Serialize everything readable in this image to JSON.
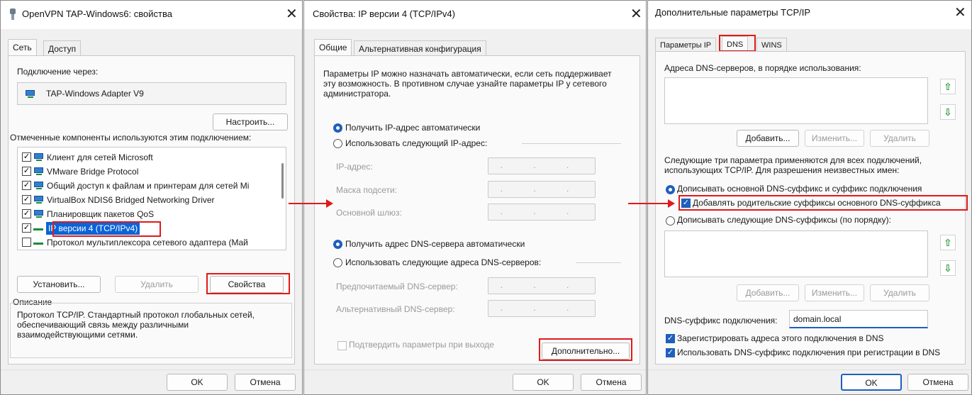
{
  "w1": {
    "title": "OpenVPN TAP-Windows6: свойства",
    "tabs": [
      "Сеть",
      "Доступ"
    ],
    "connect_via_label": "Подключение через:",
    "adapter_name": "TAP-Windows Adapter V9",
    "configure_button": "Настроить...",
    "components_label": "Отмеченные компоненты используются этим подключением:",
    "components": [
      {
        "label": "Клиент для сетей Microsoft",
        "checked": "✓"
      },
      {
        "label": "VMware Bridge Protocol",
        "checked": "✓"
      },
      {
        "label": "Общий доступ к файлам и принтерам для сетей Mi",
        "checked": "✓"
      },
      {
        "label": "VirtualBox NDIS6 Bridged Networking Driver",
        "checked": "✓"
      },
      {
        "label": "Планировщик пакетов QoS",
        "checked": "✓"
      },
      {
        "label": "IP версии 4 (TCP/IPv4)",
        "checked": "✓"
      },
      {
        "label": "Протокол мультиплексора сетевого адаптера (Maй",
        "checked": ""
      }
    ],
    "install_button": "Установить...",
    "remove_button": "Удалить",
    "properties_button": "Свойства",
    "description_title": "Описание",
    "description_text": "Протокол TCP/IP. Стандартный протокол глобальных сетей, обеспечивающий связь между различными взаимодействующими сетями.",
    "ok_button": "OK",
    "cancel_button": "Отмена"
  },
  "w2": {
    "title": "Свойства: IP версии 4 (TCP/IPv4)",
    "tabs": [
      "Общие",
      "Альтернативная конфигурация"
    ],
    "intro_text": "Параметры IP можно назначать автоматически, если сеть поддерживает эту возможность. В противном случае узнайте параметры IP у сетевого администратора.",
    "auto_ip": "Получить IP-адрес автоматически",
    "manual_ip": "Использовать следующий IP-адрес:",
    "ip_label": "IP-адрес:",
    "mask_label": "Маска подсети:",
    "gateway_label": "Основной шлюз:",
    "ip_placeholder": ". . .",
    "auto_dns": "Получить адрес DNS-сервера автоматически",
    "manual_dns": "Использовать следующие адреса DNS-серверов:",
    "pref_dns_label": "Предпочитаемый DNS-сервер:",
    "alt_dns_label": "Альтернативный DNS-сервер:",
    "validate_label": "Подтвердить параметры при выходе",
    "advanced_button": "Дополнительно...",
    "ok_button": "OK",
    "cancel_button": "Отмена"
  },
  "w3": {
    "title": "Дополнительные параметры TCP/IP",
    "tabs": [
      "Параметры IP",
      "DNS",
      "WINS"
    ],
    "dns_servers_label": "Адреса DNS-серверов, в порядке использования:",
    "add_button": "Добавить...",
    "edit_button": "Изменить...",
    "remove_button": "Удалить",
    "following_text": "Следующие три параметра применяются для всех подключений, использующих TCP/IP. Для разрешения неизвестных имен:",
    "append_primary": "Дописывать основной DNS-суффикс и суффикс подключения",
    "append_parent": "Добавлять родительские суффиксы основного DNS-суффикса",
    "append_these": "Дописывать следующие DNS-суффиксы (по порядку):",
    "conn_suffix_label": "DNS-суффикс подключения:",
    "conn_suffix_value": "domain.local",
    "register_addr": "Зарегистрировать адреса этого подключения в DNS",
    "use_suffix": "Использовать DNS-суффикс подключения при регистрации в DNS",
    "ok_button": "OK",
    "cancel_button": "Отмена"
  },
  "colors": {
    "accent": "#1f5fbd",
    "highlight_red": "#e11919",
    "selection": "#0a64d8"
  }
}
